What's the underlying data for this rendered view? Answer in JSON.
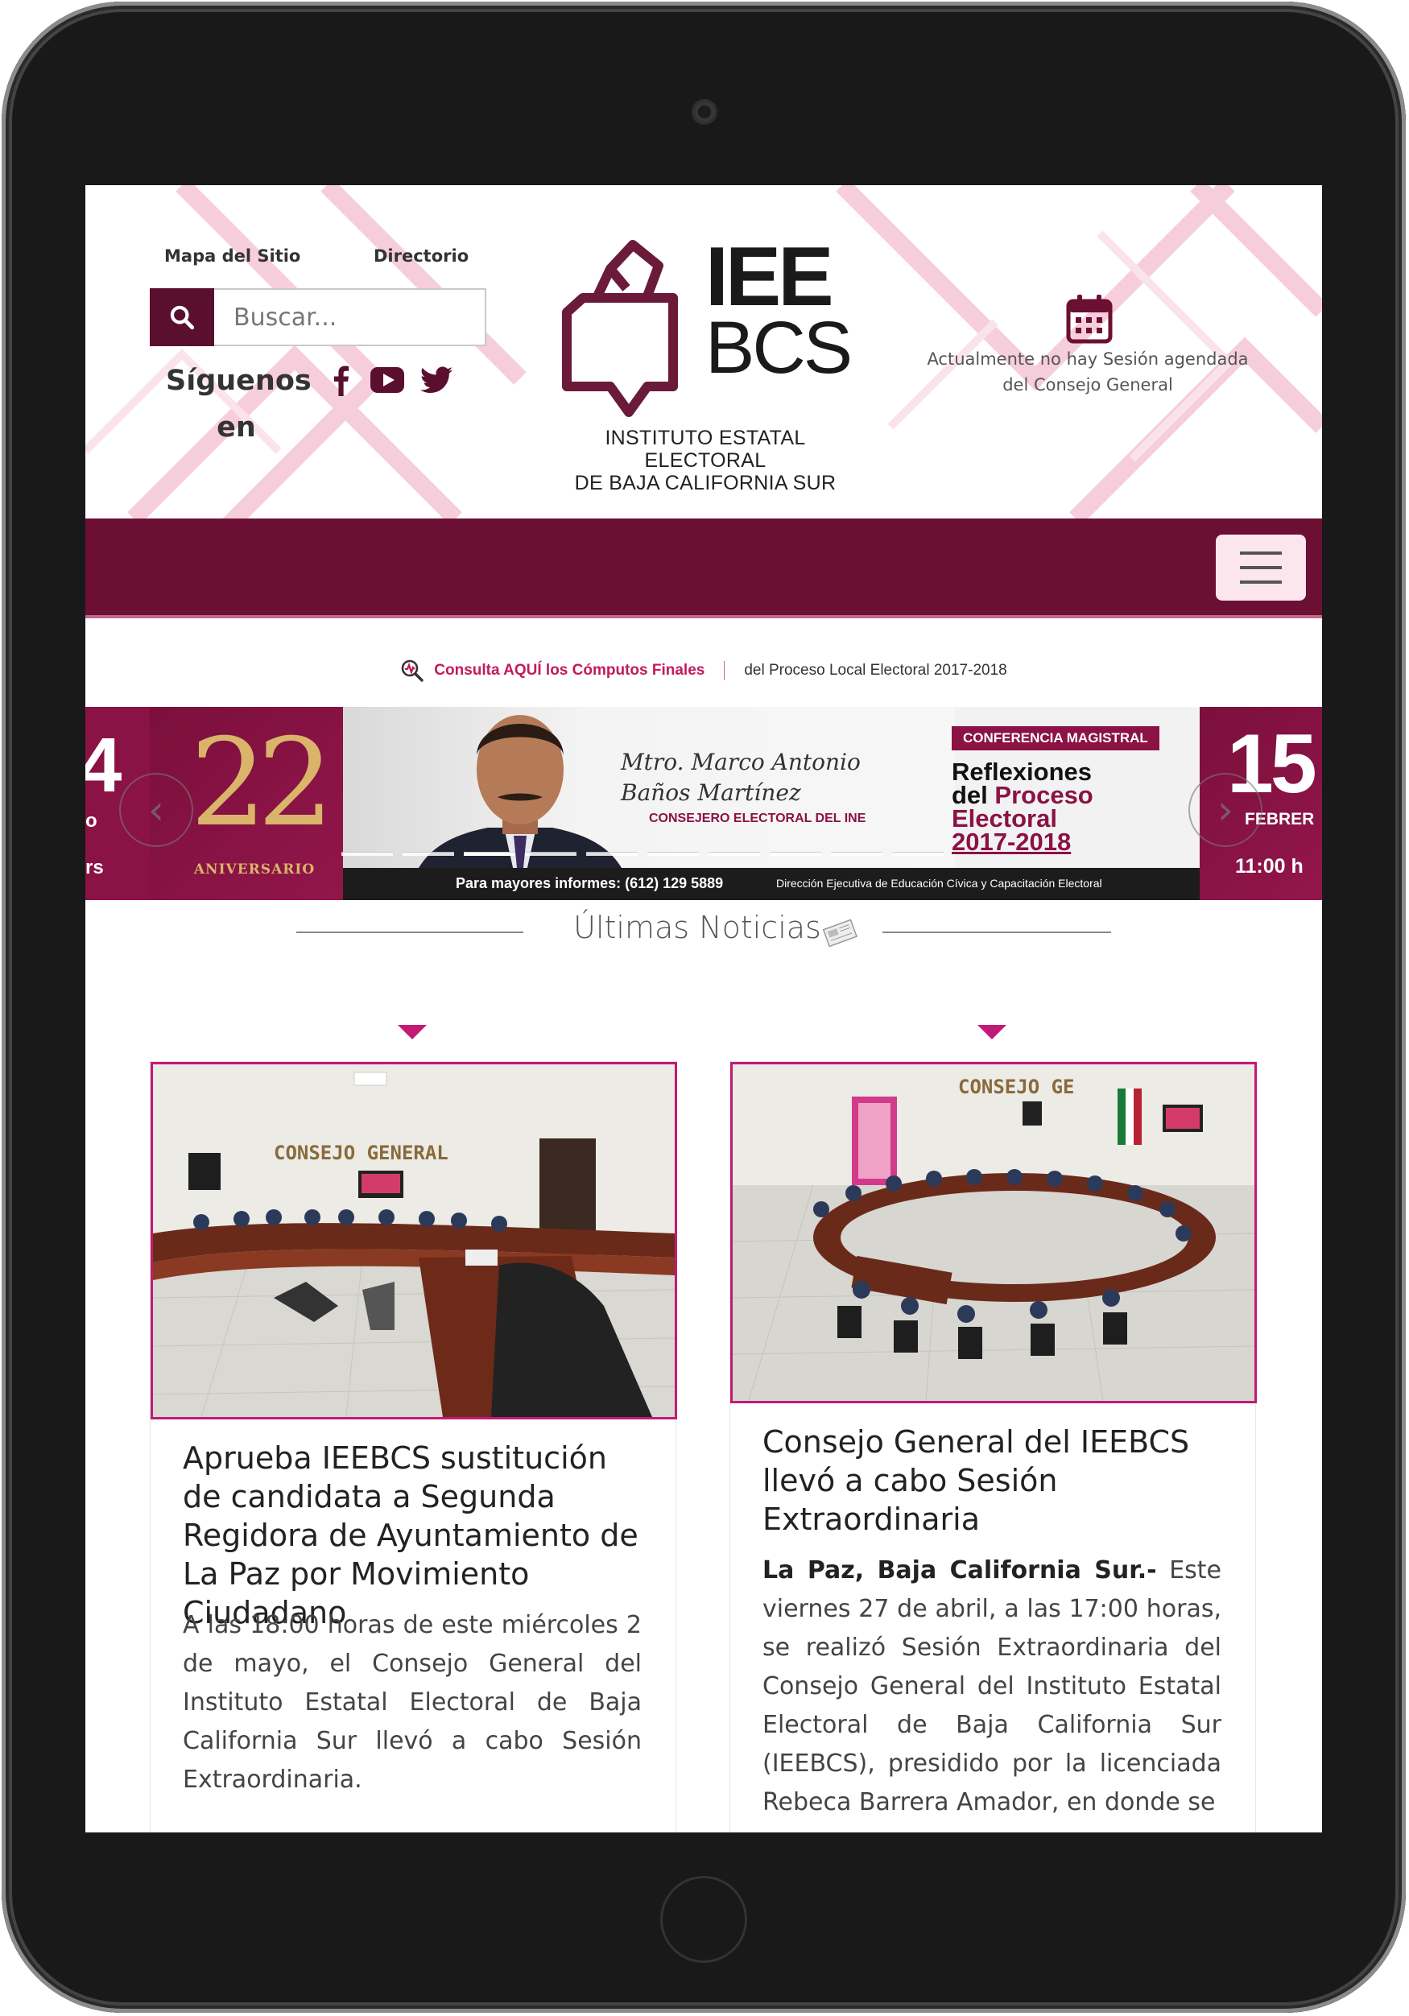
{
  "header": {
    "top_links": [
      "Mapa del Sitio",
      "Directorio"
    ],
    "search": {
      "placeholder": "Buscar..."
    },
    "follow_label": "Síguenos en",
    "social_icons": [
      "facebook-icon",
      "youtube-icon",
      "twitter-icon"
    ],
    "logo": {
      "line1": "IEE",
      "line2": "BCS",
      "caption_line1": "INSTITUTO ESTATAL ELECTORAL",
      "caption_line2": "DE BAJA CALIFORNIA SUR"
    },
    "session_notice": "Actualmente no hay Sesión agendada del Consejo General"
  },
  "computos": {
    "link_text": "Consulta AQUÍ los Cómputos Finales",
    "suffix": "del Proceso Local Electoral 2017-2018"
  },
  "slider": {
    "left_panel": {
      "numeral": "4",
      "fragment_1": "o",
      "fragment_2": "rs"
    },
    "anniversary": {
      "number": "22",
      "label": "ANIVERSARIO"
    },
    "speaker": {
      "name_line1": "Mtro. Marco Antonio",
      "name_line2": "Baños Martínez",
      "role": "CONSEJERO ELECTORAL DEL INE"
    },
    "conference": {
      "badge": "CONFERENCIA MAGISTRAL",
      "title_line1": "Reflexiones",
      "title_line2a": "del ",
      "title_line2b": "Proceso",
      "title_line3": "Electoral",
      "title_line4": "2017-2018"
    },
    "date": {
      "day": "15",
      "month": "FEBRER",
      "time": "11:00 h"
    },
    "info_phone": "Para mayores informes: (612) 129 5889",
    "info_department": "Dirección Ejecutiva de Educación Cívica y Capacitación Electoral",
    "dots_count": 10,
    "active_dot": 2
  },
  "news": {
    "heading": "Últimas Noticias",
    "articles": [
      {
        "title": "Aprueba IEEBCS sustitución de candidata a Segunda Regidora de Ayuntamiento de La Paz por Movimiento Ciudadano",
        "body": "A las 18:00 horas de este miércoles 2 de mayo, el Consejo General del Instituto Estatal Electoral de Baja California Sur llevó a cabo Sesión Extraordinaria.",
        "photo_sign": "CONSEJO GENERAL"
      },
      {
        "title": "Consejo General del IEEBCS llevó a cabo Sesión Extraordinaria",
        "body_lead": "La Paz, Baja California Sur.-",
        "body": " Este viernes 27 de abril, a las 17:00 horas, se realizó Sesión Extraordinaria del Consejo General del Instituto Estatal Electoral de Baja California Sur (IEEBCS), presidido por la licenciada Rebeca Barrera Amador, en donde se",
        "photo_sign": "CONSEJO GE"
      }
    ]
  },
  "colors": {
    "brand_maroon": "#6b0f33",
    "accent_magenta": "#c21a76",
    "link_pink": "#c21a5c"
  }
}
